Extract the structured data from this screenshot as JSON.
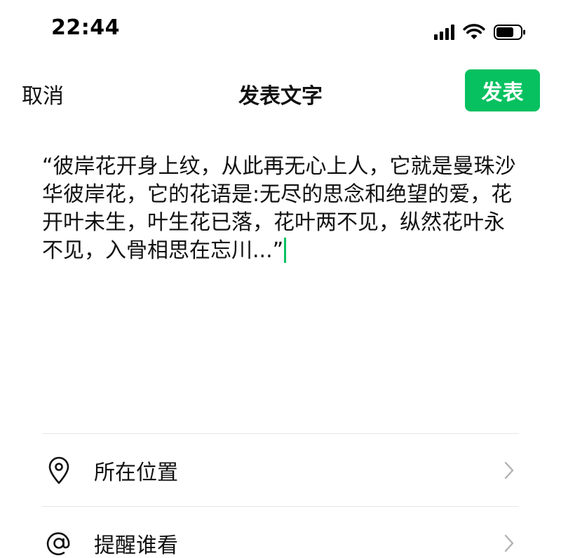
{
  "status_bar": {
    "time": "22:44"
  },
  "nav": {
    "cancel_label": "取消",
    "title": "发表文字",
    "publish_label": "发表"
  },
  "post": {
    "text": "“彼岸花开身上纹，从此再无心上人，它就是曼珠沙华彼岸花，它的花语是:无尽的思念和绝望的爱，花开叶未生，叶生花已落，花叶两不见，纵然花叶永不见，入骨相思在忘川...”"
  },
  "options": [
    {
      "label": "所在位置",
      "icon": "location-pin-icon"
    },
    {
      "label": "提醒谁看",
      "icon": "at-icon"
    }
  ],
  "colors": {
    "accent": "#07c160",
    "text": "#111111",
    "divider": "#e5e5e5",
    "chevron": "#b2b2b2"
  }
}
